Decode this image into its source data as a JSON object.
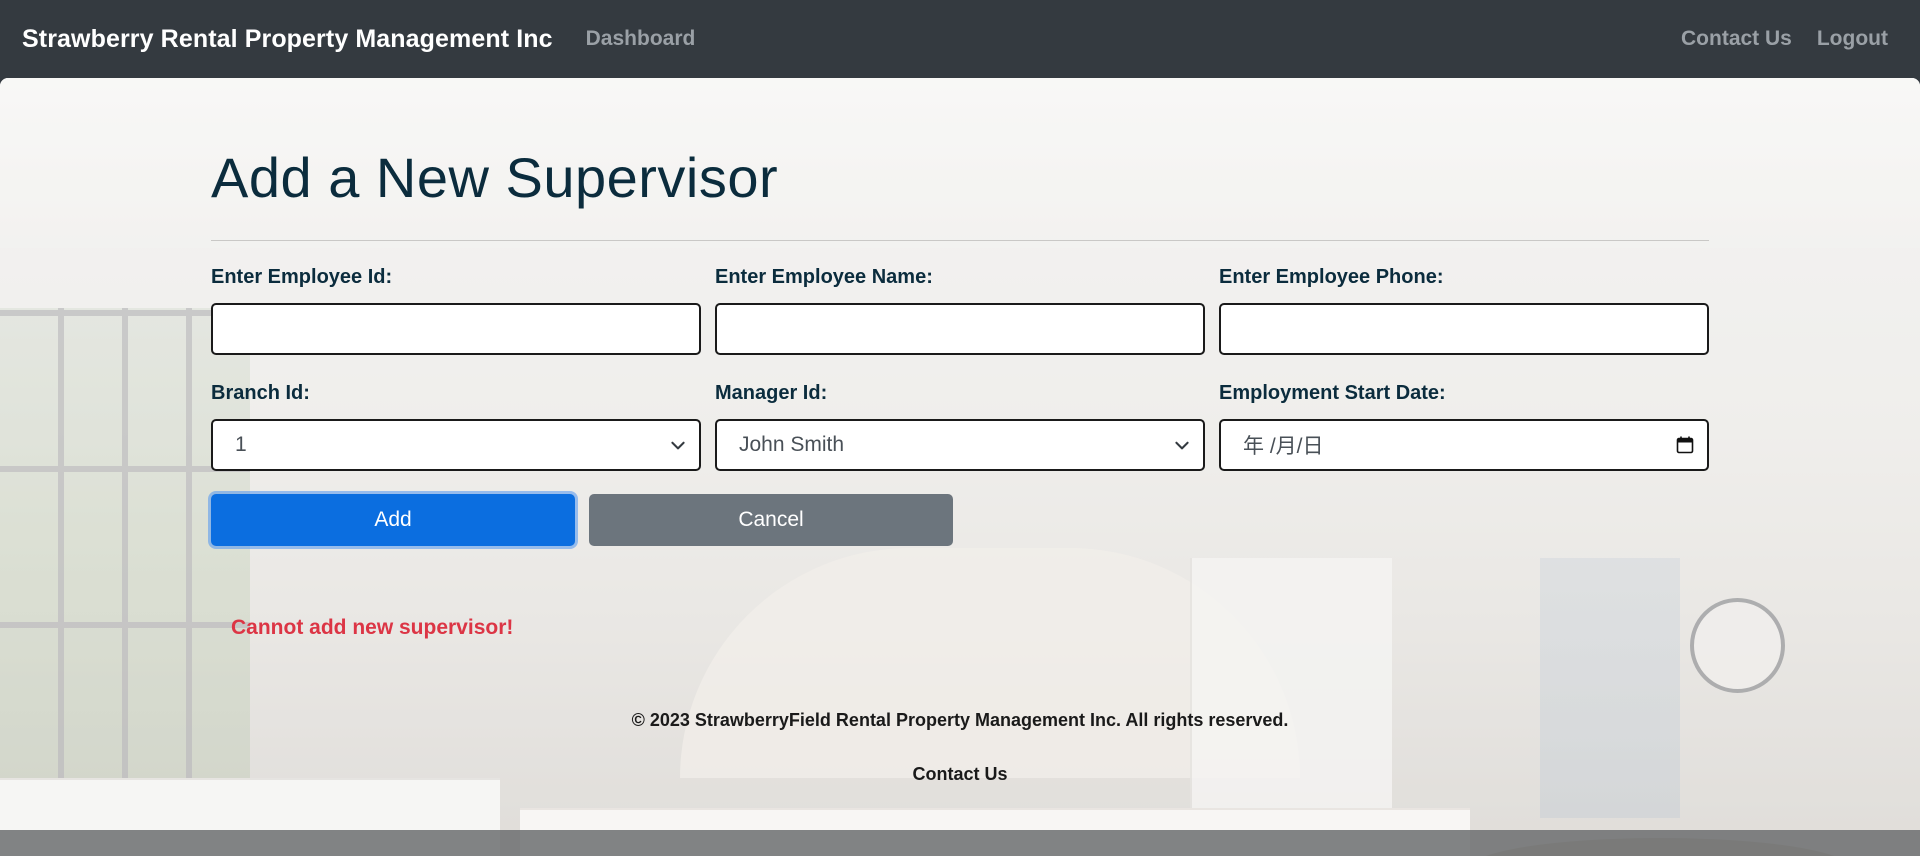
{
  "navbar": {
    "brand": "Strawberry Rental Property Management Inc",
    "dashboard": "Dashboard",
    "contact": "Contact Us",
    "logout": "Logout"
  },
  "form": {
    "title": "Add a New Supervisor",
    "employee_id": {
      "label": "Enter Employee Id:",
      "value": ""
    },
    "employee_name": {
      "label": "Enter Employee Name:",
      "value": ""
    },
    "employee_phone": {
      "label": "Enter Employee Phone:",
      "value": ""
    },
    "branch_id": {
      "label": "Branch Id:",
      "selected": "1"
    },
    "manager_id": {
      "label": "Manager Id:",
      "selected": "John Smith"
    },
    "start_date": {
      "label": "Employment Start Date:",
      "placeholder": "年 /月/日"
    },
    "add_label": "Add",
    "cancel_label": "Cancel",
    "error": "Cannot add new supervisor!"
  },
  "footer": {
    "copyright": "© 2023 StrawberryField Rental Property Management Inc. All rights reserved.",
    "contact": "Contact Us"
  },
  "colors": {
    "navbar_bg": "#343a40",
    "primary": "#0b6ee0",
    "secondary": "#6c757d",
    "error": "#dc3545",
    "heading": "#0b2c3d"
  },
  "icons": {
    "select_arrow": "chevron-down-icon",
    "date_picker": "calendar-icon"
  }
}
